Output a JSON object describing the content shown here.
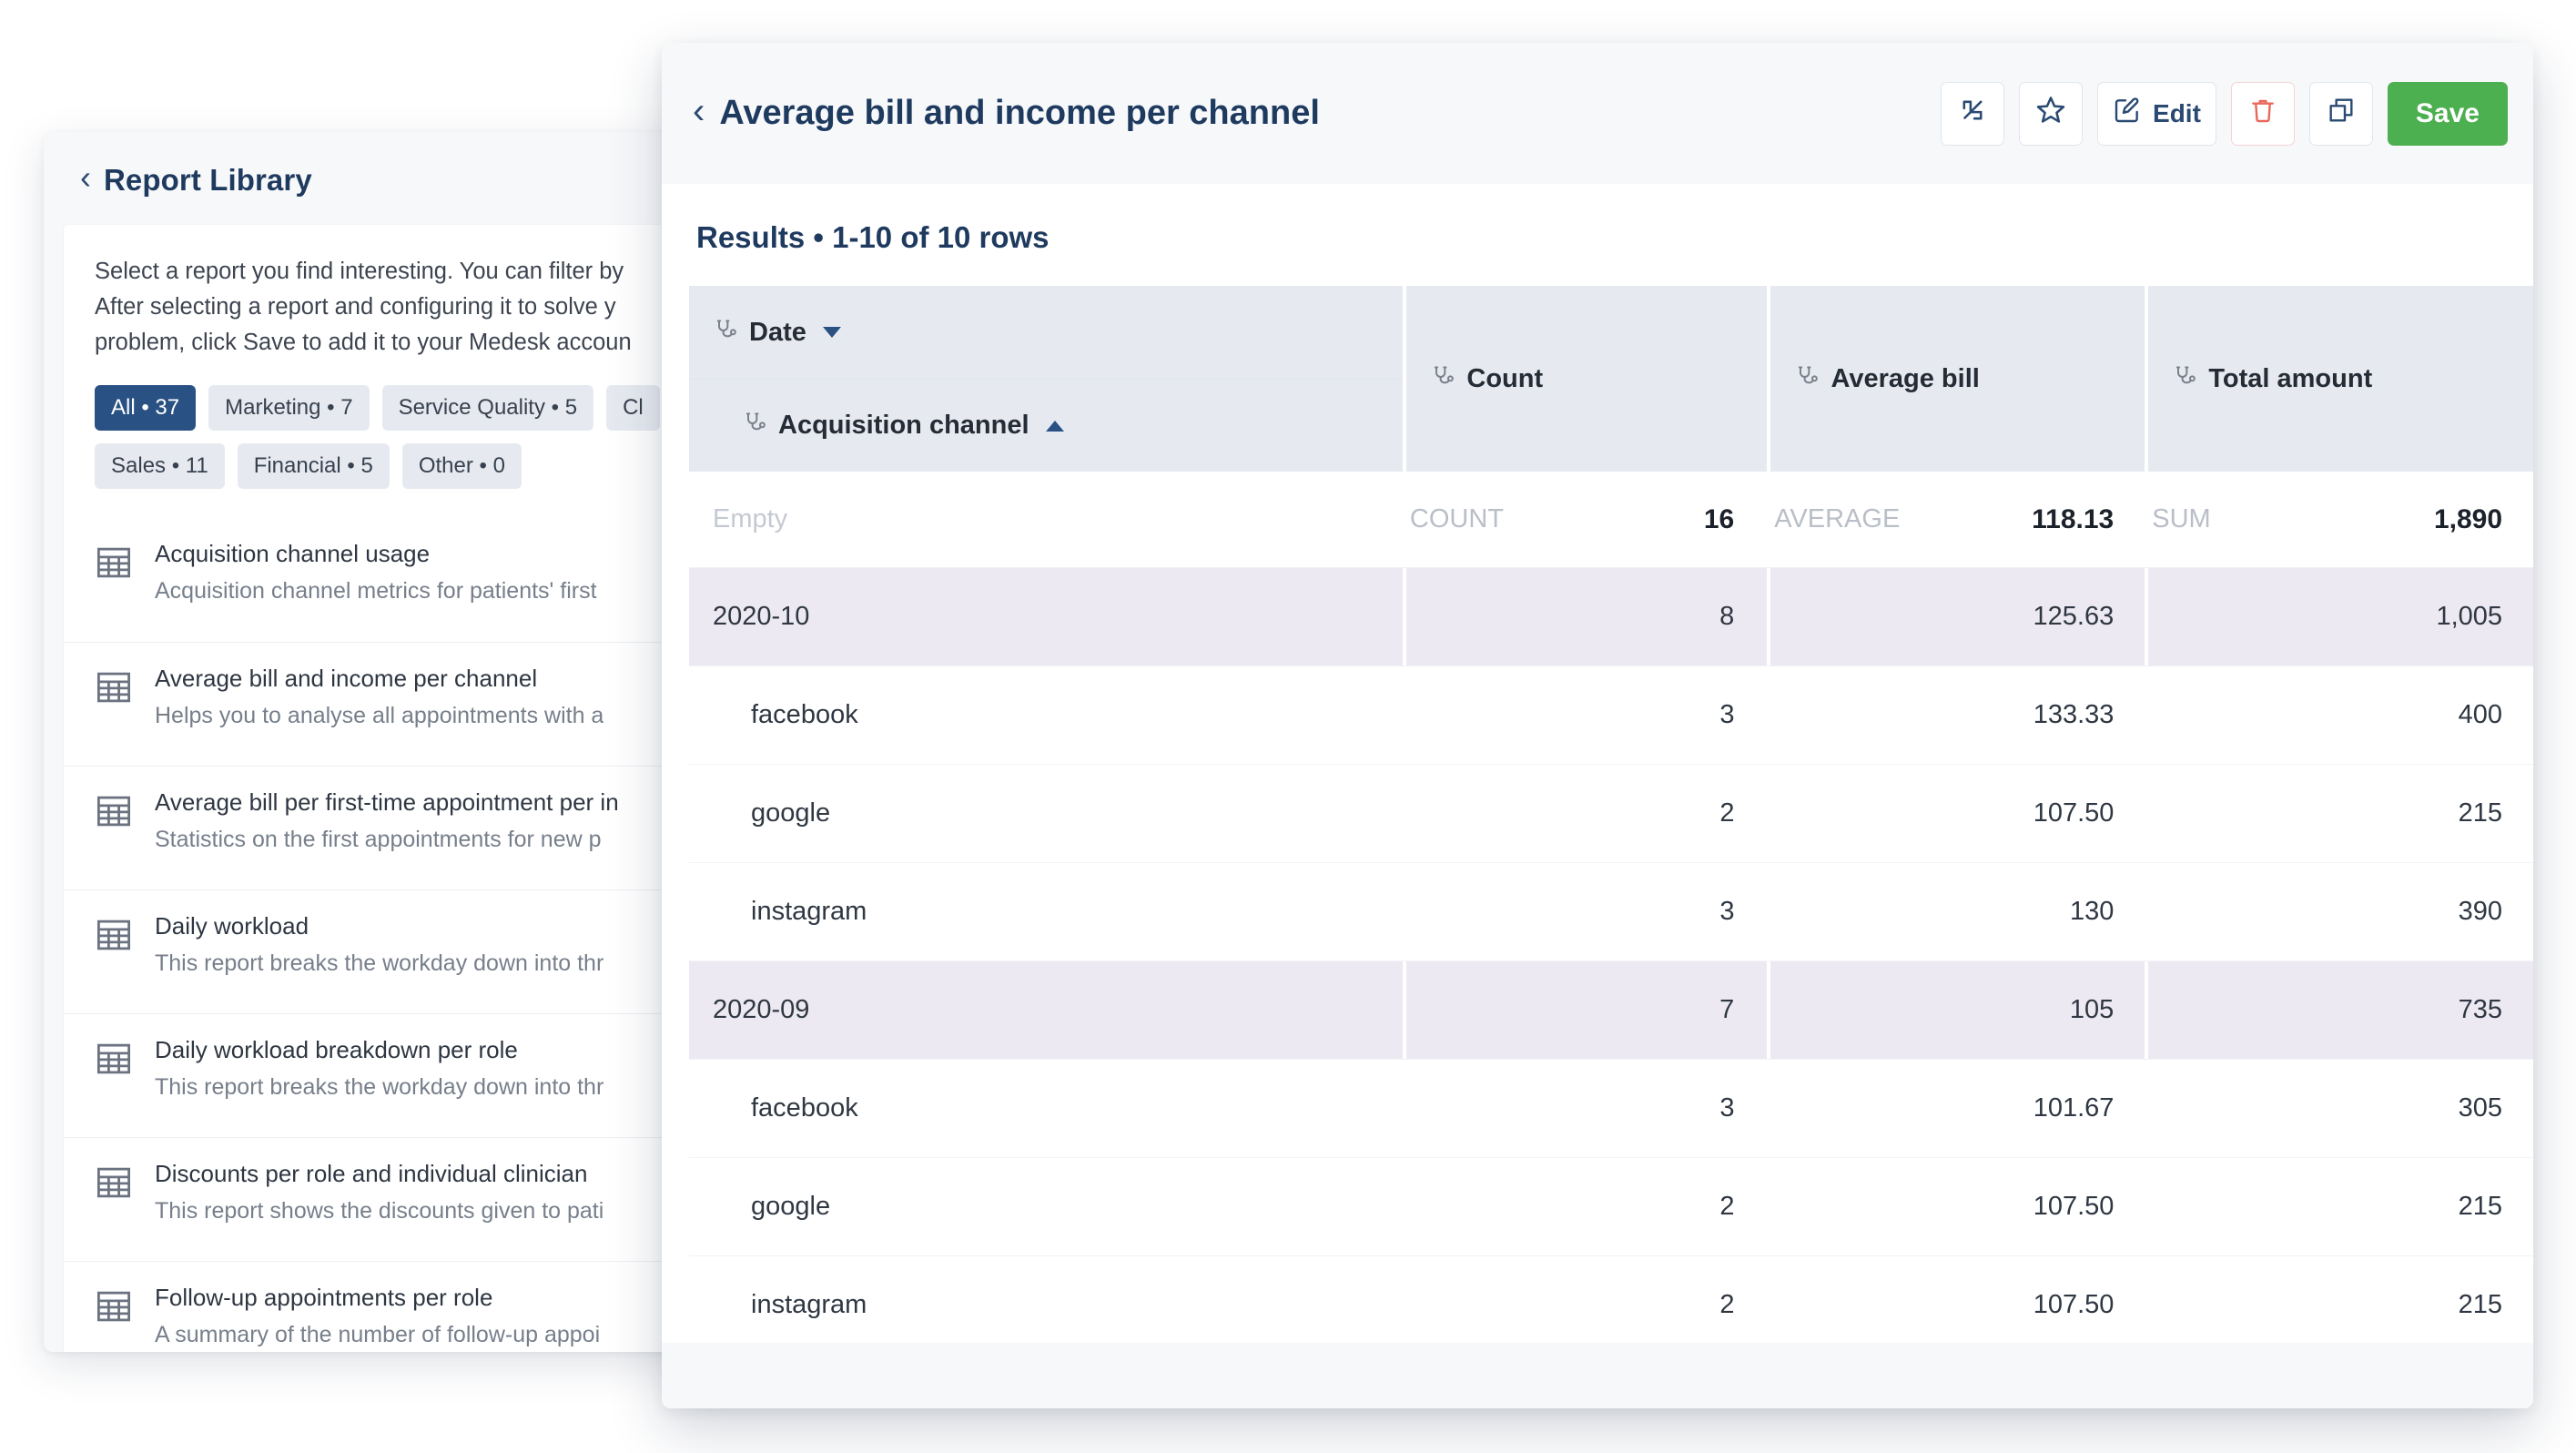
{
  "library": {
    "back_icon": "chevron-left-icon",
    "title": "Report Library",
    "description_line1": "Select a report you find interesting. You can filter by",
    "description_line2": "After selecting a report and configuring it to solve y",
    "description_line3": "problem, click Save to add it to your Medesk accoun",
    "chips_row1": [
      {
        "label": "All • 37",
        "active": true
      },
      {
        "label": "Marketing • 7",
        "active": false
      },
      {
        "label": "Service Quality • 5",
        "active": false
      },
      {
        "label": "Cl",
        "active": false
      }
    ],
    "chips_row2": [
      {
        "label": "Sales • 11",
        "active": false
      },
      {
        "label": "Financial • 5",
        "active": false
      },
      {
        "label": "Other • 0",
        "active": false
      }
    ],
    "reports": [
      {
        "icon": "table-icon",
        "name": "Acquisition channel usage",
        "desc": "Acquisition channel metrics for patients' first"
      },
      {
        "icon": "table-icon",
        "name": "Average bill and income per channel",
        "desc": "Helps you to analyse all appointments with a"
      },
      {
        "icon": "table-icon",
        "name": "Average bill per first-time appointment per in",
        "desc": "Statistics on the first appointments for new p"
      },
      {
        "icon": "table-icon",
        "name": "Daily workload",
        "desc": "This report breaks the workday down into thr"
      },
      {
        "icon": "table-icon",
        "name": "Daily workload breakdown per role",
        "desc": "This report breaks the workday down into thr"
      },
      {
        "icon": "table-icon",
        "name": "Discounts per role and individual clinician",
        "desc": "This report shows the discounts given to pati"
      },
      {
        "icon": "table-icon",
        "name": "Follow-up appointments per role",
        "desc": "A summary of the number of follow-up appoi"
      }
    ]
  },
  "modal": {
    "back_icon": "chevron-left-icon",
    "title": "Average bill and income per channel",
    "actions": [
      {
        "name": "expand-button",
        "icon": "expand-diagonal-icon",
        "label": ""
      },
      {
        "name": "favorite-button",
        "icon": "star-icon",
        "label": ""
      },
      {
        "name": "edit-button",
        "icon": "pencil-square-icon",
        "label": "Edit"
      },
      {
        "name": "delete-button",
        "icon": "trash-icon",
        "label": ""
      },
      {
        "name": "duplicate-button",
        "icon": "copy-icon",
        "label": ""
      },
      {
        "name": "save-button",
        "icon": "",
        "label": "Save"
      }
    ],
    "results_heading": "Results • 1-10 of 10 rows",
    "columns": [
      {
        "key": "date",
        "label": "Date",
        "icon": "stethoscope-icon",
        "sort": "desc"
      },
      {
        "key": "channel",
        "label": "Acquisition channel",
        "icon": "stethoscope-icon",
        "sort": "asc"
      },
      {
        "key": "count",
        "label": "Count",
        "icon": "stethoscope-icon",
        "sort": "none"
      },
      {
        "key": "avg_bill",
        "label": "Average bill",
        "icon": "stethoscope-icon",
        "sort": "none"
      },
      {
        "key": "total",
        "label": "Total amount",
        "icon": "stethoscope-icon",
        "sort": "none"
      }
    ],
    "summary_row": {
      "label": "Empty",
      "count_agg": "COUNT",
      "count_value": "16",
      "avg_agg": "AVERAGE",
      "avg_value": "118.13",
      "total_agg": "SUM",
      "total_value": "1,890"
    },
    "rows": [
      {
        "type": "group",
        "label": "2020-10",
        "count": "8",
        "avg_bill": "125.63",
        "total": "1,005"
      },
      {
        "type": "leaf",
        "label": "facebook",
        "count": "3",
        "avg_bill": "133.33",
        "total": "400"
      },
      {
        "type": "leaf",
        "label": "google",
        "count": "2",
        "avg_bill": "107.50",
        "total": "215"
      },
      {
        "type": "leaf",
        "label": "instagram",
        "count": "3",
        "avg_bill": "130",
        "total": "390"
      },
      {
        "type": "group",
        "label": "2020-09",
        "count": "7",
        "avg_bill": "105",
        "total": "735"
      },
      {
        "type": "leaf",
        "label": "facebook",
        "count": "3",
        "avg_bill": "101.67",
        "total": "305"
      },
      {
        "type": "leaf",
        "label": "google",
        "count": "2",
        "avg_bill": "107.50",
        "total": "215"
      },
      {
        "type": "leaf",
        "label": "instagram",
        "count": "2",
        "avg_bill": "107.50",
        "total": "215"
      }
    ]
  },
  "colors": {
    "accent_navy": "#1f3a5f",
    "chip_active": "#2a5183",
    "save_green": "#4caf50",
    "danger_red": "#e8685c",
    "header_grey": "#e6eaf0",
    "group_lavender": "#ede9f2"
  }
}
